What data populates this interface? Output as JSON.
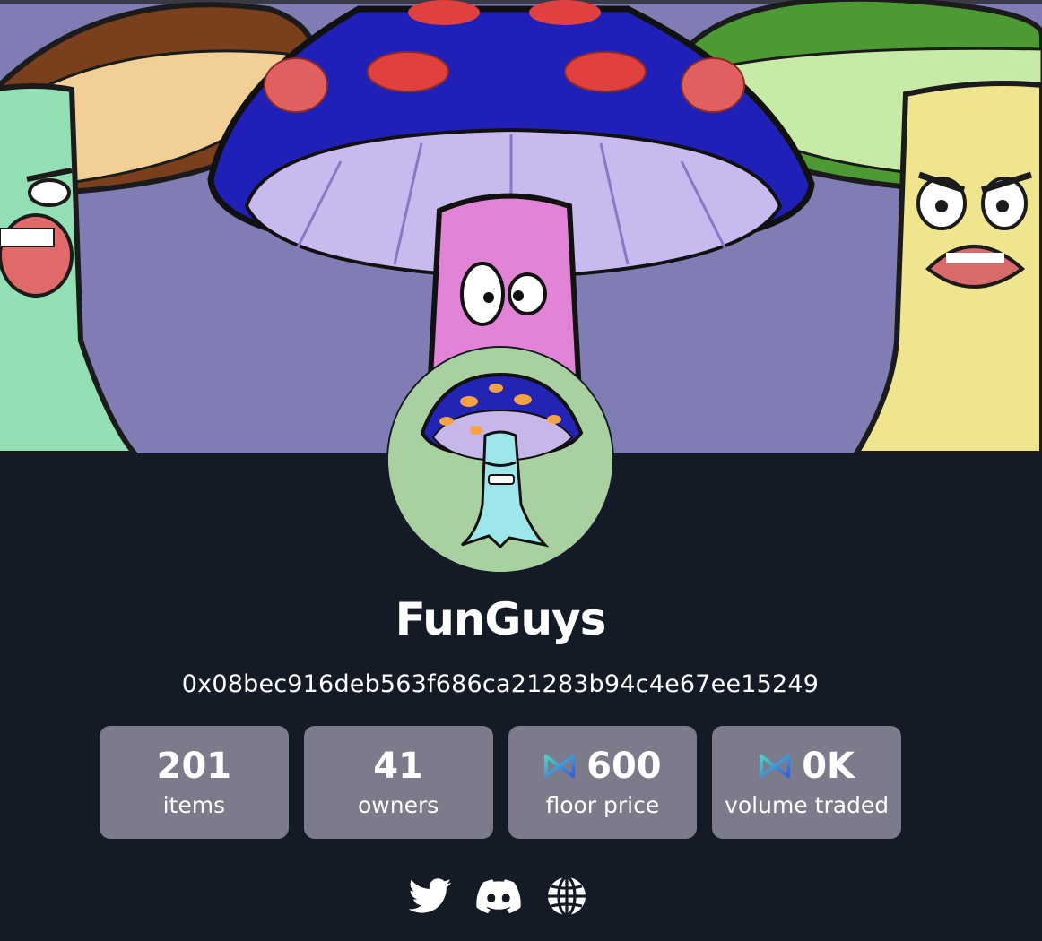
{
  "collection": {
    "name": "FunGuys",
    "address": "0x08bec916deb563f686ca21283b94c4e67ee15249"
  },
  "stats": [
    {
      "value": "201",
      "label": "items",
      "icon": null
    },
    {
      "value": "41",
      "label": "owners",
      "icon": null
    },
    {
      "value": "600",
      "label": "floor price",
      "icon": "ronin-token-icon"
    },
    {
      "value": "0K",
      "label": "volume traded",
      "icon": "ronin-token-icon"
    }
  ],
  "socials": [
    {
      "name": "twitter",
      "icon": "twitter-icon"
    },
    {
      "name": "discord",
      "icon": "discord-icon"
    },
    {
      "name": "website",
      "icon": "globe-icon"
    }
  ],
  "colors": {
    "background": "#141a26",
    "banner_bg": "#7f7db3",
    "stat_card": "#7b7b8b",
    "avatar_bg": "#a9d0a0",
    "token_icon_gradient": [
      "#4fd1c5",
      "#3b5bdb"
    ]
  }
}
